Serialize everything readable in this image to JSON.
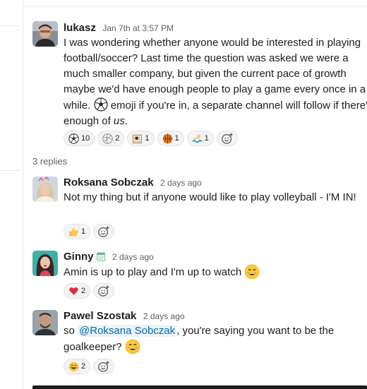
{
  "thread": {
    "replies_label": "3 replies",
    "parent": {
      "author": "lukasz",
      "timestamp": "Jan 7th at 3:57 PM",
      "text_before": "I was wondering whether anyone would be interested in playing football/soccer? Last time the question was asked we were a much smaller company, but given the current pace of growth maybe we'd have enough people to play a game every once in a while.",
      "text_after": " emoji if you're in, a separate channel will follow if there's enough of ",
      "text_em": "us",
      "text_end": ".",
      "reactions": [
        {
          "icon": "soccer-ball-icon",
          "count": "10"
        },
        {
          "icon": "volleyball-icon",
          "count": "2"
        },
        {
          "icon": "goal-net-icon",
          "count": "1"
        },
        {
          "icon": "basketball-icon",
          "count": "1"
        },
        {
          "icon": "swimmer-icon",
          "count": "1"
        }
      ]
    },
    "replies": [
      {
        "author": "Roksana Sobczak",
        "timestamp": "2 days ago",
        "text": "Not my thing but if anyone would like to play volleyball - I'M IN!",
        "reactions": [
          {
            "icon": "thumbs-up-icon",
            "count": "1"
          }
        ]
      },
      {
        "author": "Ginny",
        "timestamp": "2 days ago",
        "status_icon": "calendar-status-icon",
        "text": "Amin is up to play and I'm up to watch",
        "reactions": [
          {
            "icon": "heart-icon",
            "count": "2"
          }
        ]
      },
      {
        "author": "Pawel Szostak",
        "timestamp": "2 days ago",
        "text_before": "so ",
        "mention": "@Roksana Sobczak",
        "text_after": ", you're saying you want to be the goalkeeper?",
        "reactions": [
          {
            "icon": "joy-icon",
            "count": "2"
          }
        ]
      }
    ]
  },
  "colors": {
    "link": "#1264a3",
    "mention_bg": "#e8f5fa",
    "muted": "#616061",
    "reaction_bg": "#f3f3f3"
  }
}
